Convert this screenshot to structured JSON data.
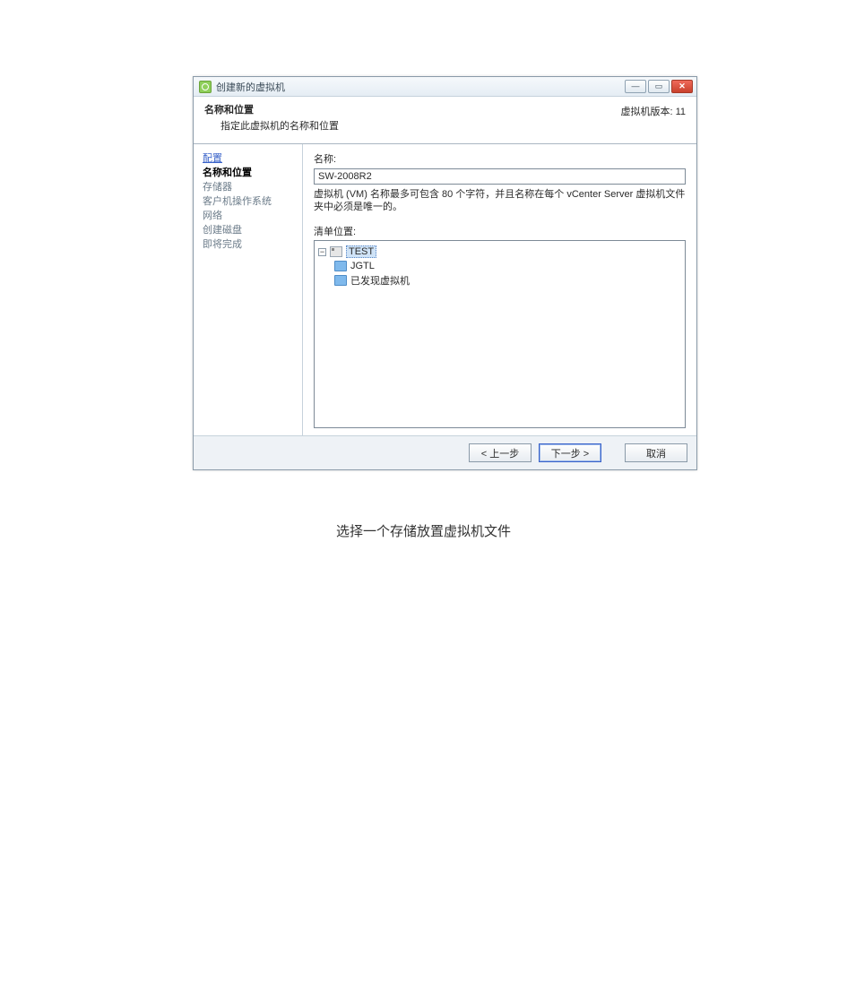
{
  "window": {
    "title": "创建新的虚拟机"
  },
  "header": {
    "title": "名称和位置",
    "subtitle": "指定此虚拟机的名称和位置",
    "version": "虚拟机版本: 11"
  },
  "sidebar": {
    "items": [
      {
        "label": "配置",
        "state": "past"
      },
      {
        "label": "名称和位置",
        "state": "current"
      },
      {
        "label": "存储器",
        "state": "future"
      },
      {
        "label": "客户机操作系统",
        "state": "future"
      },
      {
        "label": "网络",
        "state": "future"
      },
      {
        "label": "创建磁盘",
        "state": "future"
      },
      {
        "label": "即将完成",
        "state": "future"
      }
    ]
  },
  "content": {
    "name_label": "名称:",
    "name_value": "SW-2008R2",
    "hint": "虚拟机 (VM) 名称最多可包含 80 个字符，并且名称在每个 vCenter Server 虚拟机文件夹中必须是唯一的。",
    "inventory_label": "清单位置:",
    "tree": {
      "root": {
        "label": "TEST",
        "expanded": true,
        "selected": true
      },
      "children": [
        {
          "label": "JGTL"
        },
        {
          "label": "已发现虚拟机"
        }
      ]
    }
  },
  "buttons": {
    "back": "< 上一步",
    "next": "下一步 >",
    "cancel": "取消"
  },
  "caption": "选择一个存储放置虚拟机文件",
  "glyphs": {
    "minimize": "—",
    "maximize": "▭",
    "close": "✕",
    "minus": "−"
  }
}
